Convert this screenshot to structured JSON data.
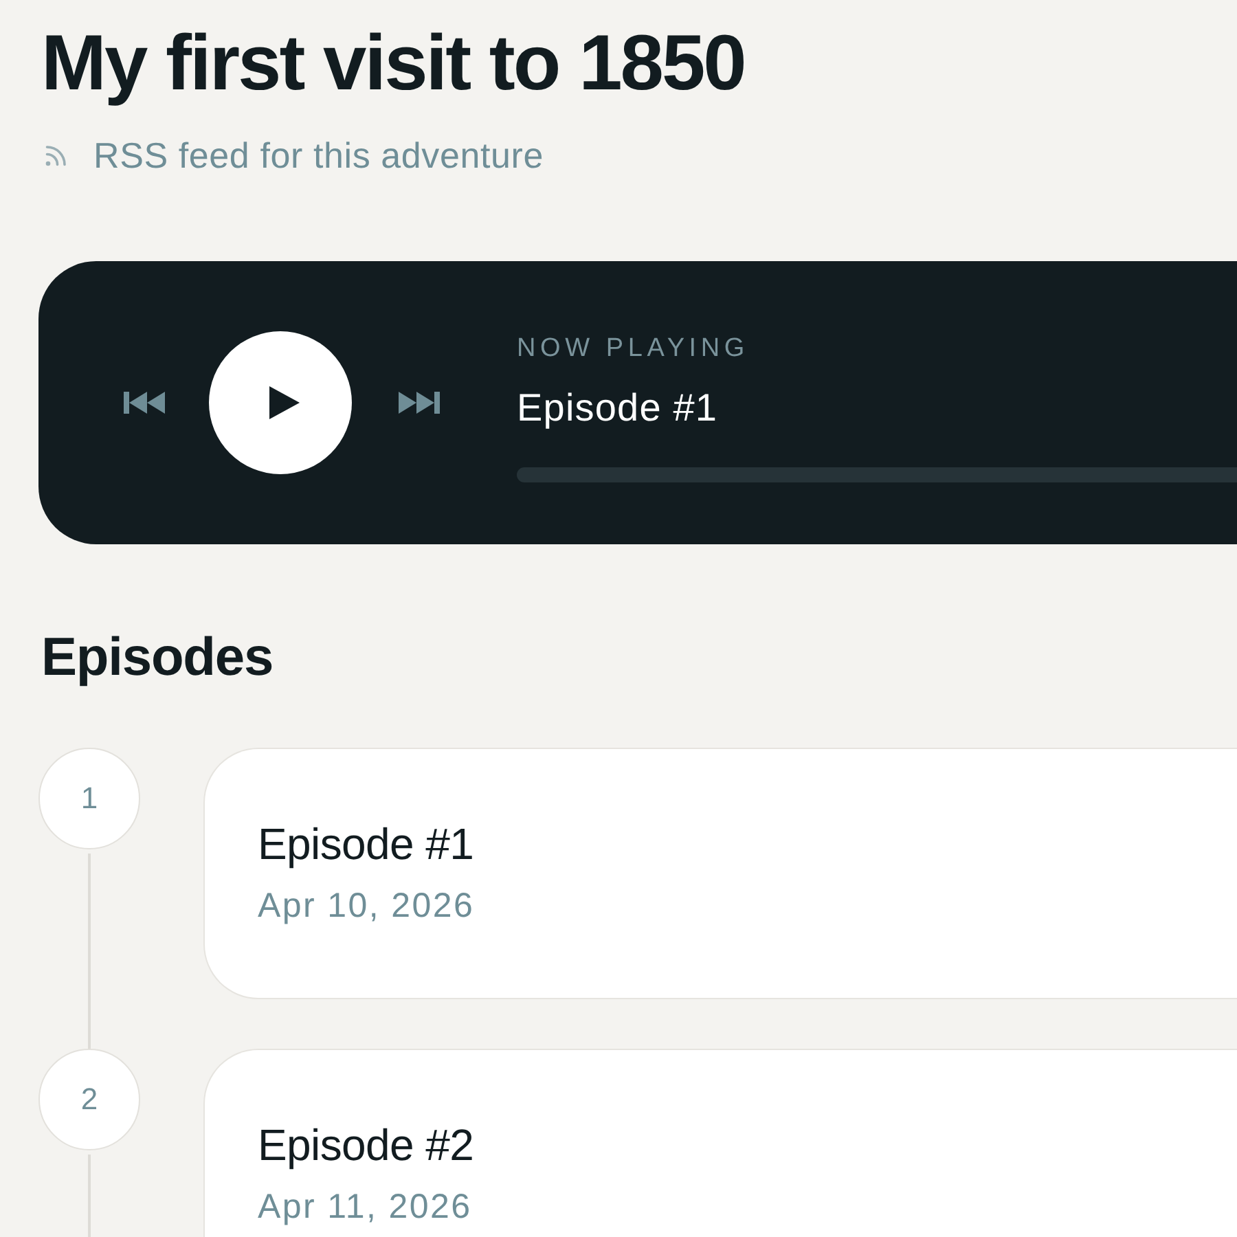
{
  "page": {
    "title": "My first visit to 1850",
    "rss_link": "RSS feed for this adventure"
  },
  "player": {
    "label": "NOW PLAYING",
    "track_title": "Episode #1"
  },
  "episodes_section": {
    "heading": "Episodes",
    "episodes": [
      {
        "number": "1",
        "title": "Episode #1",
        "date": "Apr 10, 2026"
      },
      {
        "number": "2",
        "title": "Episode #2",
        "date": "Apr 11, 2026"
      }
    ]
  }
}
